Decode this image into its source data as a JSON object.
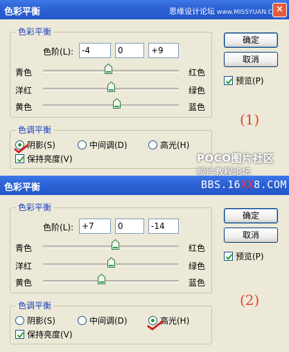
{
  "dialog1": {
    "title": "色彩平衡",
    "watermark": "思缘设计论坛",
    "watermark_site": "www.MISSYUAN.COM",
    "close_glyph": "×",
    "color_balance_group": "色彩平衡",
    "levels_label": "色阶(L):",
    "levels": [
      "-4",
      "0",
      "+9"
    ],
    "sliders": [
      {
        "left": "青色",
        "right": "红色",
        "value": -4
      },
      {
        "left": "洋红",
        "right": "绿色",
        "value": 0
      },
      {
        "left": "黄色",
        "right": "蓝色",
        "value": 9
      }
    ],
    "tone_group": "色调平衡",
    "radios": [
      {
        "label": "阴影(S)",
        "checked": true
      },
      {
        "label": "中间调(D)",
        "checked": false
      },
      {
        "label": "高光(H)",
        "checked": false
      }
    ],
    "preserve_luminosity": {
      "label": "保持亮度(V)",
      "checked": true
    },
    "buttons": {
      "ok": "确定",
      "cancel": "取消"
    },
    "preview": {
      "label": "预览(P)",
      "checked": true
    },
    "marker": "(1)"
  },
  "dialog2": {
    "title": "色彩平衡",
    "watermark": "BBS.16XX8.COM",
    "watermark_parts": [
      "BBS.16",
      "XX",
      "8.COM"
    ],
    "color_balance_group": "色彩平衡",
    "levels_label": "色阶(L):",
    "levels": [
      "+7",
      "0",
      "-14"
    ],
    "sliders": [
      {
        "left": "青色",
        "right": "红色",
        "value": 7
      },
      {
        "left": "洋红",
        "right": "绿色",
        "value": 0
      },
      {
        "left": "黄色",
        "right": "蓝色",
        "value": -14
      }
    ],
    "tone_group": "色调平衡",
    "radios": [
      {
        "label": "阴影(S)",
        "checked": false
      },
      {
        "label": "中间调(D)",
        "checked": false
      },
      {
        "label": "高光(H)",
        "checked": true
      }
    ],
    "preserve_luminosity": {
      "label": "保持亮度(V)",
      "checked": true
    },
    "buttons": {
      "ok": "确定",
      "cancel": "取消"
    },
    "preview": {
      "label": "预览(P)",
      "checked": true
    },
    "marker": "(2)"
  },
  "overlay": {
    "poco": "POCO图片社区",
    "poco_sub": "照片教程论坛"
  },
  "colors": {
    "group_title": "#1a3fc0",
    "marker": "#e0472a",
    "checkmark_red": "#d02020",
    "radio_dot": "#21a121"
  }
}
